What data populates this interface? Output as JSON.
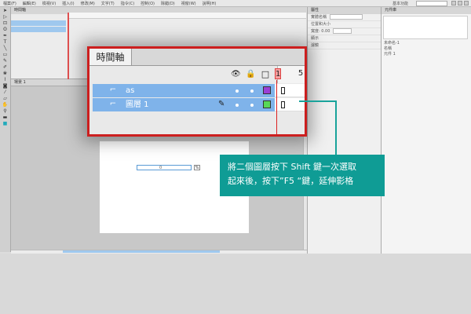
{
  "menubar": {
    "items": [
      "檔案(F)",
      "編輯(E)",
      "檢視(V)",
      "插入(I)",
      "修改(M)",
      "文字(T)",
      "指令(C)",
      "控制(O)",
      "除錯(D)",
      "視窗(W)",
      "說明(H)"
    ],
    "workspace": "基本功能"
  },
  "small_timeline": {
    "tab": "時間軸"
  },
  "stage_bar": {
    "scene": "場景 1"
  },
  "stage": {
    "input_value": "0"
  },
  "properties": {
    "tab": "屬性",
    "lines": [
      "實體名稱",
      "位置和大小",
      "寬度: 0.00",
      "顯示",
      "濾鏡"
    ]
  },
  "library": {
    "tab": "元件庫",
    "lines": [
      "未命名-1",
      "名稱",
      "元件 1"
    ]
  },
  "zoom_timeline": {
    "tab": "時間軸",
    "frame_current": "1",
    "frame_five": "5",
    "layers": [
      {
        "name": "as",
        "color": "#9b3fd6"
      },
      {
        "name": "圖層 1",
        "color": "#58d858"
      }
    ]
  },
  "callout": {
    "line1": "將二個圖層按下 Shift 鍵一次選取",
    "line2": "起來後，按下”F5 “鍵，延伸影格"
  },
  "icons": [
    "eye-icon",
    "lock-icon",
    "outline-icon",
    "layer-icon",
    "pencil-icon"
  ],
  "colors": {
    "highlight_border": "#cc1f1f",
    "callout_bg": "#0f9c95",
    "layer_selected": "#7fb3ea"
  }
}
